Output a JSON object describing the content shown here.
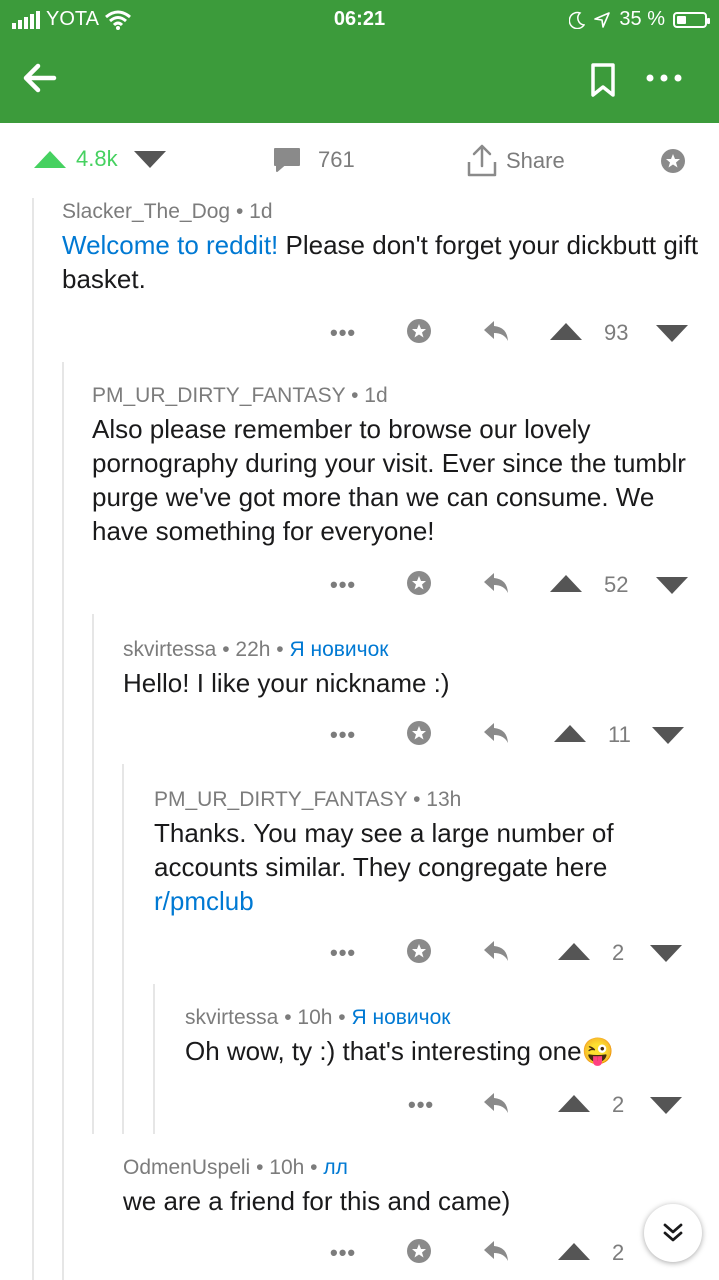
{
  "status_bar": {
    "carrier": "YOTA",
    "time": "06:21",
    "battery_percent": "35 %",
    "battery_level": 0.35
  },
  "colors": {
    "header": "#3c9b3b",
    "upvote_active": "#46d160",
    "link": "#0079d3",
    "icon": "#7c7c7c"
  },
  "icons": [
    "back-arrow-icon",
    "bookmark-icon",
    "more-icon",
    "upvote-icon",
    "downvote-icon",
    "comment-icon",
    "share-icon",
    "award-icon",
    "reply-icon",
    "chevron-double-down-icon"
  ],
  "post_actions": {
    "score": "4.8k",
    "comments": "761",
    "share": "Share"
  },
  "comments": [
    {
      "author": "Slacker_The_Dog",
      "age": "1d",
      "flair": "",
      "body_link": "Welcome to reddit!",
      "body": "Please don't forget your dickbutt gift basket.",
      "score": "93"
    },
    {
      "author": "PM_UR_DIRTY_FANTASY",
      "age": "1d",
      "flair": "",
      "body": "Also please remember to browse our lovely pornography during your visit. Ever since the tumblr purge we've got more than we can consume. We have something for everyone!",
      "score": "52"
    },
    {
      "author": "skvirtessa",
      "age": "22h",
      "flair": "Я новичок",
      "body": "Hello! I like your nickname :)",
      "score": "11"
    },
    {
      "author": "PM_UR_DIRTY_FANTASY",
      "age": "13h",
      "flair": "",
      "body": "Thanks. You may see a large number of accounts similar.  They congregate here",
      "body_link": "r/pmclub",
      "score": "2"
    },
    {
      "author": "skvirtessa",
      "age": "10h",
      "flair": "Я новичок",
      "body": "Oh wow, ty :) that's interesting one",
      "emoji": "😜",
      "score": "2"
    },
    {
      "author": "OdmenUspeli",
      "age": "10h",
      "flair": "лл",
      "body": "we are a friend for this and came)",
      "score": "2"
    }
  ],
  "separator": "•"
}
